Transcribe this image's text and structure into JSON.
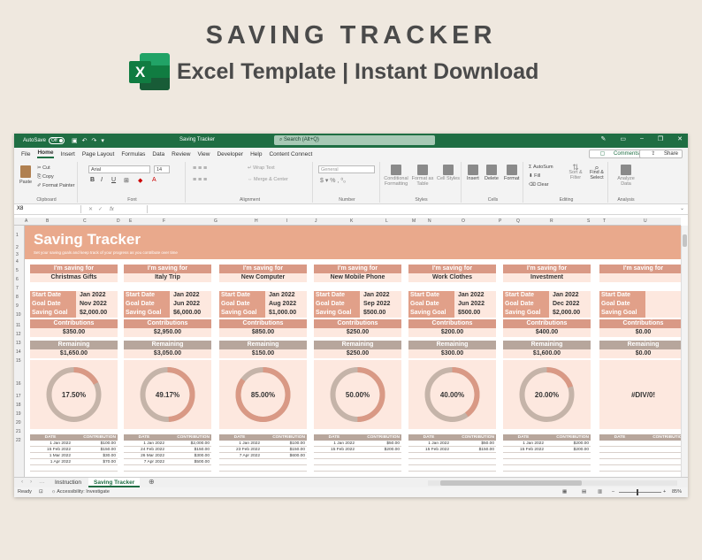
{
  "promo": {
    "title": "SAVING TRACKER",
    "subtitle": "Excel Template | Instant Download",
    "logo_letter": "X"
  },
  "window": {
    "autosave_label": "AutoSave",
    "autosave_state": "Off",
    "doc_title": "Saving Tracker",
    "search_placeholder": "Search (Alt+Q)",
    "menu": [
      "File",
      "Home",
      "Insert",
      "Page Layout",
      "Formulas",
      "Data",
      "Review",
      "View",
      "Developer",
      "Help",
      "Content Connect"
    ],
    "active_menu": "Home",
    "comments": "Comments",
    "share": "Share"
  },
  "ribbon": {
    "clipboard": {
      "paste": "Paste",
      "cut": "Cut",
      "copy": "Copy",
      "format_painter": "Format Painter",
      "label": "Clipboard"
    },
    "font": {
      "name": "Arial",
      "size": "14",
      "label": "Font"
    },
    "alignment": {
      "wrap": "Wrap Text",
      "merge": "Merge & Center",
      "label": "Alignment"
    },
    "number": {
      "format": "General",
      "label": "Number"
    },
    "styles": {
      "conditional": "Conditional Formatting",
      "format_as_table": "Format as Table",
      "cell_styles": "Cell Styles",
      "label": "Styles"
    },
    "cells": {
      "insert": "Insert",
      "delete": "Delete",
      "format": "Format",
      "label": "Cells"
    },
    "editing": {
      "autosum": "AutoSum",
      "fill": "Fill",
      "clear": "Clear",
      "sort": "Sort & Filter",
      "find": "Find & Select",
      "label": "Editing"
    },
    "analysis": {
      "analyze": "Analyze Data",
      "label": "Analysis"
    }
  },
  "formula_bar": {
    "name_box": "X8",
    "fx": "fx"
  },
  "columns": [
    "A",
    "B",
    "C",
    "D",
    "E",
    "F",
    "G",
    "H",
    "I",
    "J",
    "K",
    "L",
    "M",
    "N",
    "O",
    "P",
    "Q",
    "R",
    "S",
    "T",
    "U"
  ],
  "rows": [
    "1",
    "2",
    "3",
    "4",
    "5",
    "6",
    "7",
    "8",
    "9",
    "10",
    "11",
    "12",
    "13",
    "14",
    "15",
    "16",
    "17",
    "18",
    "19",
    "20",
    "21",
    "22"
  ],
  "sheet": {
    "title": "Saving Tracker",
    "subtitle": "Set your saving goals and keep track of your progress as you contribute over time",
    "labels": {
      "saving_for": "I'm saving for",
      "start": "Start Date",
      "goal": "Goal Date",
      "saving_goal": "Saving Goal",
      "contributions": "Contributions",
      "remaining": "Remaining",
      "date_col": "DATE",
      "contrib_col": "CONTRIBUTION"
    },
    "cards": [
      {
        "name": "Christmas Gifts",
        "start": "Jan 2022",
        "goal_date": "Nov 2022",
        "goal": "$2,000.00",
        "contributions": "$350.00",
        "remaining": "$1,650.00",
        "percent_label": "17.50%",
        "percent": 0.175,
        "entries": [
          [
            "1 Jan 2022",
            "$100.00"
          ],
          [
            "15 Feb 2022",
            "$150.00"
          ],
          [
            "1 Mar 2022",
            "$30.00"
          ],
          [
            "1 Apr 2022",
            "$70.00"
          ]
        ]
      },
      {
        "name": "Italy Trip",
        "start": "Jan 2022",
        "goal_date": "Jun 2022",
        "goal": "$6,000.00",
        "contributions": "$2,950.00",
        "remaining": "$3,050.00",
        "percent_label": "49.17%",
        "percent": 0.4917,
        "entries": [
          [
            "1 Jan 2022",
            "$2,000.00"
          ],
          [
            "24 Feb 2022",
            "$150.00"
          ],
          [
            "26 Mar 2022",
            "$300.00"
          ],
          [
            "7 Apr 2022",
            "$500.00"
          ]
        ]
      },
      {
        "name": "New Computer",
        "start": "Jan 2022",
        "goal_date": "Aug 2022",
        "goal": "$1,000.00",
        "contributions": "$850.00",
        "remaining": "$150.00",
        "percent_label": "85.00%",
        "percent": 0.85,
        "entries": [
          [
            "1 Jan 2022",
            "$100.00"
          ],
          [
            "23 Feb 2022",
            "$150.00"
          ],
          [
            "7 Apr 2022",
            "$600.00"
          ]
        ]
      },
      {
        "name": "New Mobile Phone",
        "start": "Jan 2022",
        "goal_date": "Sep 2022",
        "goal": "$500.00",
        "contributions": "$250.00",
        "remaining": "$250.00",
        "percent_label": "50.00%",
        "percent": 0.5,
        "entries": [
          [
            "1 Jan 2022",
            "$50.00"
          ],
          [
            "15 Feb 2022",
            "$200.00"
          ]
        ]
      },
      {
        "name": "Work Clothes",
        "start": "Jan 2022",
        "goal_date": "Jun 2022",
        "goal": "$500.00",
        "contributions": "$200.00",
        "remaining": "$300.00",
        "percent_label": "40.00%",
        "percent": 0.4,
        "entries": [
          [
            "1 Jan 2022",
            "$50.00"
          ],
          [
            "15 Feb 2022",
            "$150.00"
          ]
        ]
      },
      {
        "name": "Investment",
        "start": "Jan 2022",
        "goal_date": "Dec 2022",
        "goal": "$2,000.00",
        "contributions": "$400.00",
        "remaining": "$1,600.00",
        "percent_label": "20.00%",
        "percent": 0.2,
        "entries": [
          [
            "1 Jan 2022",
            "$200.00"
          ],
          [
            "15 Feb 2022",
            "$200.00"
          ]
        ]
      },
      {
        "name": "",
        "start": "",
        "goal_date": "",
        "goal": "",
        "contributions": "$0.00",
        "remaining": "$0.00",
        "percent_label": "#DIV/0!",
        "percent": null,
        "entries": []
      }
    ]
  },
  "tabs": [
    "Instruction",
    "Saving Tracker"
  ],
  "active_tab": "Saving Tracker",
  "status": {
    "ready": "Ready",
    "accessibility": "Accessibility: Investigate",
    "zoom": "85%"
  },
  "colors": {
    "banner": "#e9a98c",
    "label_bg": "#d99985",
    "remaining_bg": "#b7a69c",
    "card_bg": "#fde8df",
    "ring_fill": "#d99985",
    "ring_track": "#c5b4a9",
    "excel_green": "#1f6e43"
  }
}
